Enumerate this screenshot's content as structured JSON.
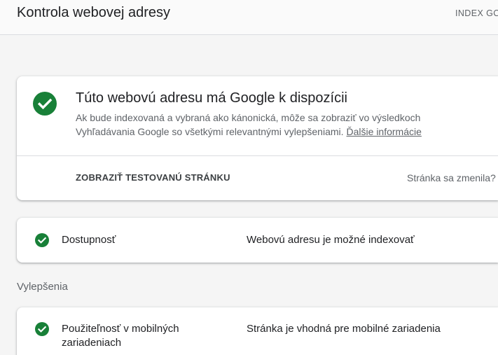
{
  "header": {
    "title": "Kontrola webovej adresy",
    "tab_label": "INDEX GO"
  },
  "status_card": {
    "icon": "check-circle-icon",
    "title": "Túto webovú adresu má Google k dispozícii",
    "description_line_1": "Ak bude indexovaná a vybraná ako kánonická, môže sa zobraziť vo výsledkoch",
    "description_line_2": "Vyhľadávania Google so všetkými relevantnými vylepšeniami.",
    "learn_more_link": "Ďalšie informácie",
    "view_tested_page_button": "ZOBRAZIŤ TESTOVANÚ STRÁNKU",
    "page_changed_text": "Stránka sa zmenila?"
  },
  "coverage": {
    "icon": "check-circle-icon",
    "label": "Dostupnosť",
    "status": "Webovú adresu je možné indexovať"
  },
  "enhancements": {
    "section_label": "Vylepšenia",
    "items": [
      {
        "icon": "check-circle-icon",
        "label": "Použiteľnosť v mobilných zariadeniach",
        "status": "Stránka je vhodná pre mobilné zariadenia"
      }
    ]
  },
  "colors": {
    "success": "#188038",
    "title_text": "#202124",
    "secondary_text": "#5f6368",
    "card_background": "#ffffff",
    "page_background": "#f5f5f5"
  }
}
